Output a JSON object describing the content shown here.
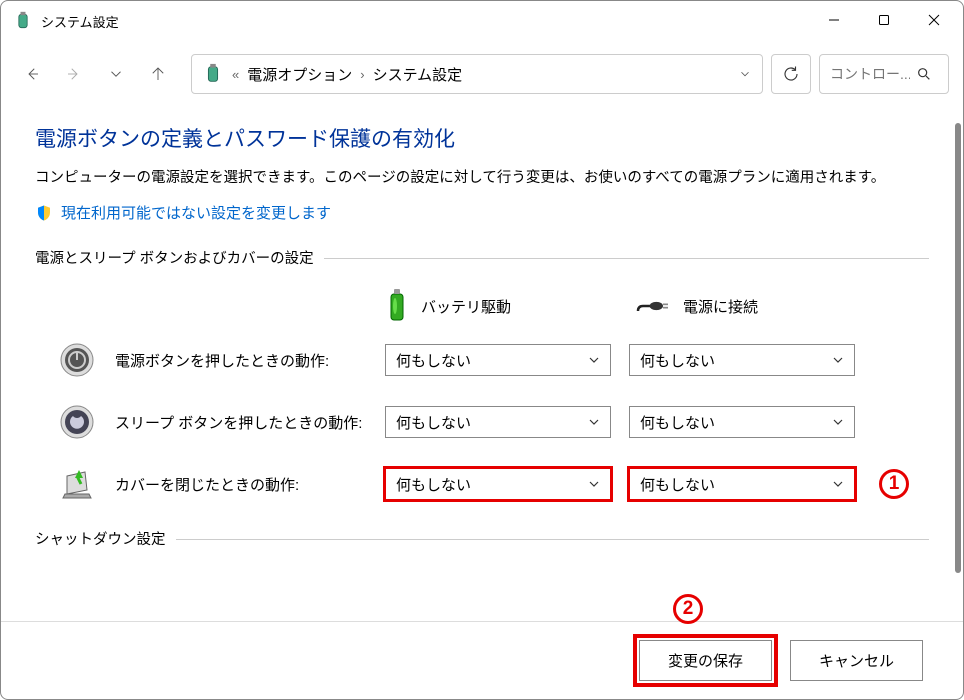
{
  "window": {
    "title": "システム設定"
  },
  "breadcrumb": {
    "prefix": "«",
    "item1": "電源オプション",
    "item2": "システム設定"
  },
  "search": {
    "placeholder": "コントロー..."
  },
  "page": {
    "heading": "電源ボタンの定義とパスワード保護の有効化",
    "description": "コンピューターの電源設定を選択できます。このページの設定に対して行う変更は、お使いのすべての電源プランに適用されます。",
    "admin_link": "現在利用可能ではない設定を変更します"
  },
  "section1": {
    "title": "電源とスリープ ボタンおよびカバーの設定",
    "col_battery": "バッテリ駆動",
    "col_ac": "電源に接続",
    "rows": [
      {
        "label": "電源ボタンを押したときの動作:",
        "battery": "何もしない",
        "ac": "何もしない"
      },
      {
        "label": "スリープ ボタンを押したときの動作:",
        "battery": "何もしない",
        "ac": "何もしない"
      },
      {
        "label": "カバーを閉じたときの動作:",
        "battery": "何もしない",
        "ac": "何もしない"
      }
    ]
  },
  "section2": {
    "title": "シャットダウン設定"
  },
  "markers": {
    "one": "1",
    "two": "2"
  },
  "footer": {
    "save": "変更の保存",
    "cancel": "キャンセル"
  }
}
